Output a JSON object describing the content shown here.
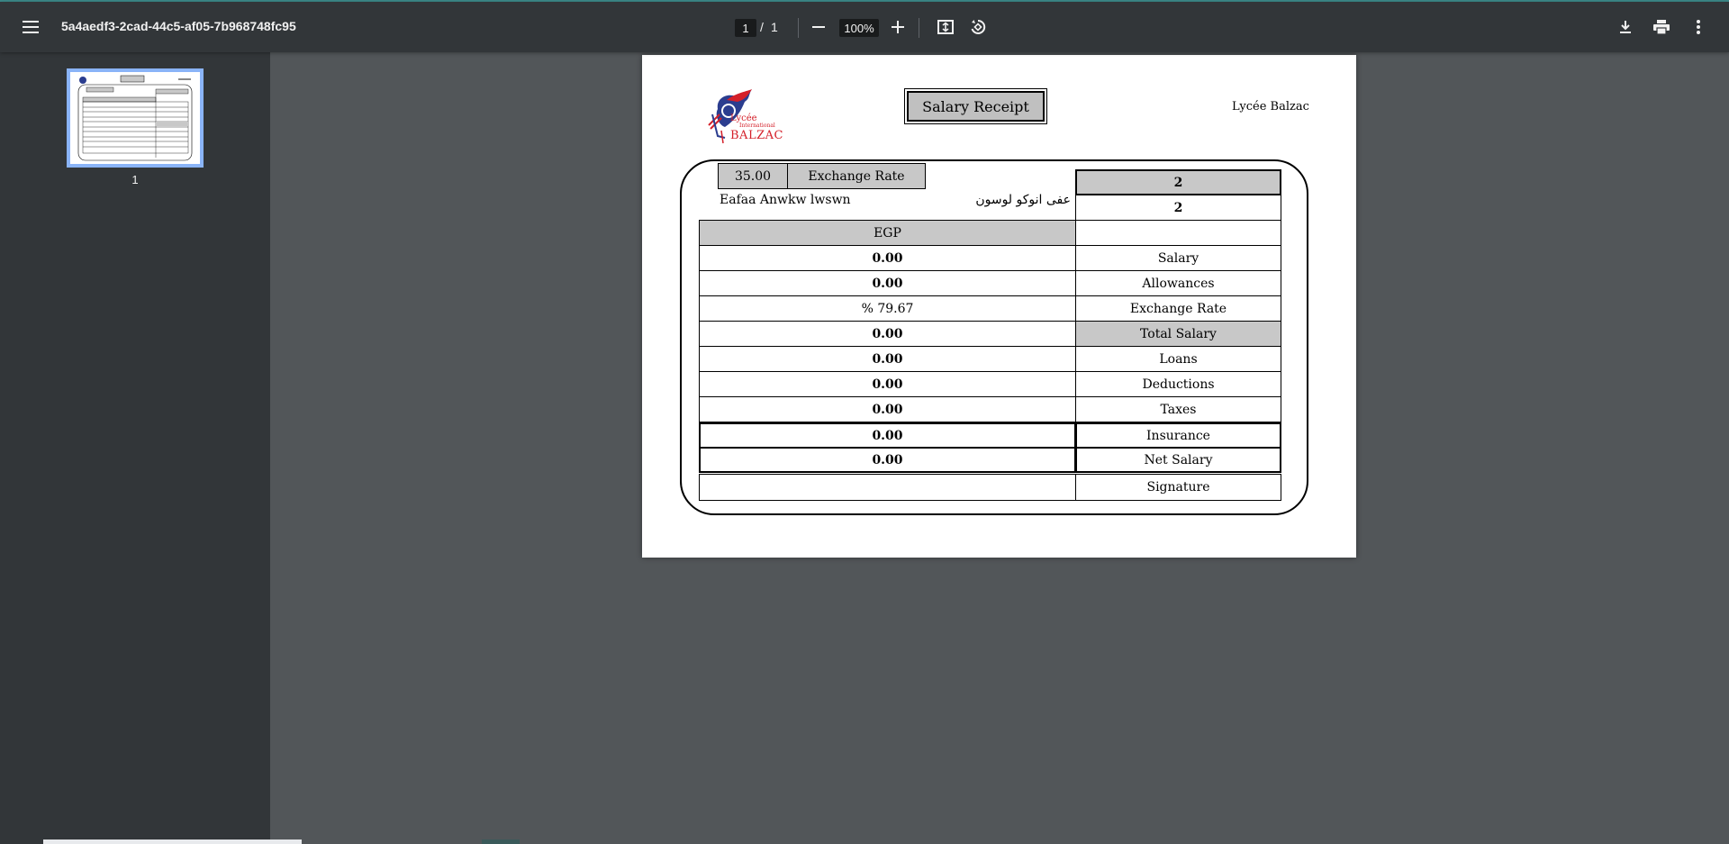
{
  "viewer": {
    "file_name": "5a4aedf3-2cad-44c5-af05-7b968748fc95",
    "current_page": "1",
    "page_separator": "/",
    "total_pages": "1",
    "zoom": "100%",
    "icons": {
      "menu": "menu-icon",
      "zoom_out": "minus-icon",
      "zoom_in": "plus-icon",
      "fit": "fit-page-icon",
      "rotate": "rotate-icon",
      "download": "download-icon",
      "print": "print-icon",
      "more": "more-vert-icon"
    }
  },
  "sidebar": {
    "thumbnails": [
      {
        "label": "1"
      }
    ]
  },
  "document": {
    "logo_text": {
      "line1": "Lycée",
      "line2": "International",
      "line3": "BALZAC"
    },
    "title": "Salary Receipt",
    "school": "Lycée Balzac",
    "exchange_value": "35.00",
    "exchange_label": "Exchange Rate",
    "code_top": "2",
    "code_second": "2",
    "employee_latin": "Eafaa Anwkw lwswn",
    "employee_arabic": "عفى انوكو لوسون",
    "currency": "EGP",
    "rows": [
      {
        "value": "0.00",
        "label": "Salary"
      },
      {
        "value": "0.00",
        "label": "Allowances"
      },
      {
        "value": "% 79.67",
        "label": "Exchange Rate"
      },
      {
        "value": "0.00",
        "label": "Total Salary"
      },
      {
        "value": "0.00",
        "label": "Loans"
      },
      {
        "value": "0.00",
        "label": "Deductions"
      },
      {
        "value": "0.00",
        "label": "Taxes"
      },
      {
        "value": "0.00",
        "label": "Insurance"
      },
      {
        "value": "0.00",
        "label": "Net Salary"
      },
      {
        "value": "",
        "label": "Signature"
      }
    ]
  },
  "colors": {
    "toolbar": "#323639",
    "viewer_background": "#525659",
    "thumbnail_highlight": "#8ab4f8",
    "table_header_grey": "#c8c8c8",
    "logo_blue": "#2b3d8f",
    "logo_red": "#d4202a"
  }
}
